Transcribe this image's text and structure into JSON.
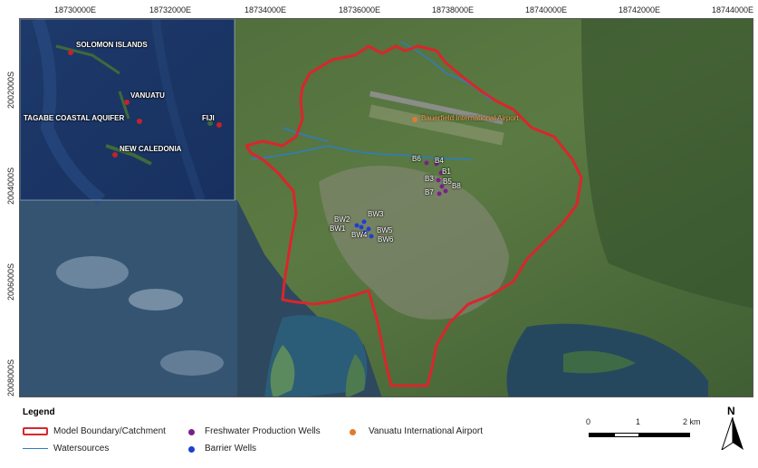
{
  "axes": {
    "x_ticks": [
      "18730000E",
      "18732000E",
      "18734000E",
      "18736000E",
      "18738000E",
      "18740000E",
      "18742000E",
      "18744000E"
    ],
    "y_ticks": [
      "2002000S",
      "2004000S",
      "2006000S",
      "2008000S"
    ]
  },
  "inset": {
    "labels": [
      "SOLOMON ISLANDS",
      "VANUATU",
      "TAGABE COASTAL AQUIFER",
      "FIJI",
      "NEW CALEDONIA"
    ]
  },
  "map": {
    "airport_label": "Bauerfield International Airport",
    "freshwater_wells": [
      "B6",
      "B4",
      "B1",
      "B3",
      "B5",
      "B8",
      "B7"
    ],
    "barrier_wells": [
      "BW2",
      "BW3",
      "BW1",
      "BW5",
      "BW4",
      "BW6"
    ]
  },
  "legend": {
    "title": "Legend",
    "items": {
      "boundary": "Model Boundary/Catchment",
      "watersources": "Watersources",
      "freshwater": "Freshwater Production Wells",
      "barrier": "Barrier Wells",
      "airport": "Vanuatu International Airport"
    }
  },
  "scalebar": {
    "labels": [
      "0",
      "1",
      "2 km"
    ]
  },
  "north_label": "N",
  "colors": {
    "boundary": "#d9262c",
    "watersources": "#2f7dc0",
    "freshwater_wells": "#7b1f8c",
    "barrier_wells": "#1f3fd0",
    "airport": "#e07b2d"
  }
}
